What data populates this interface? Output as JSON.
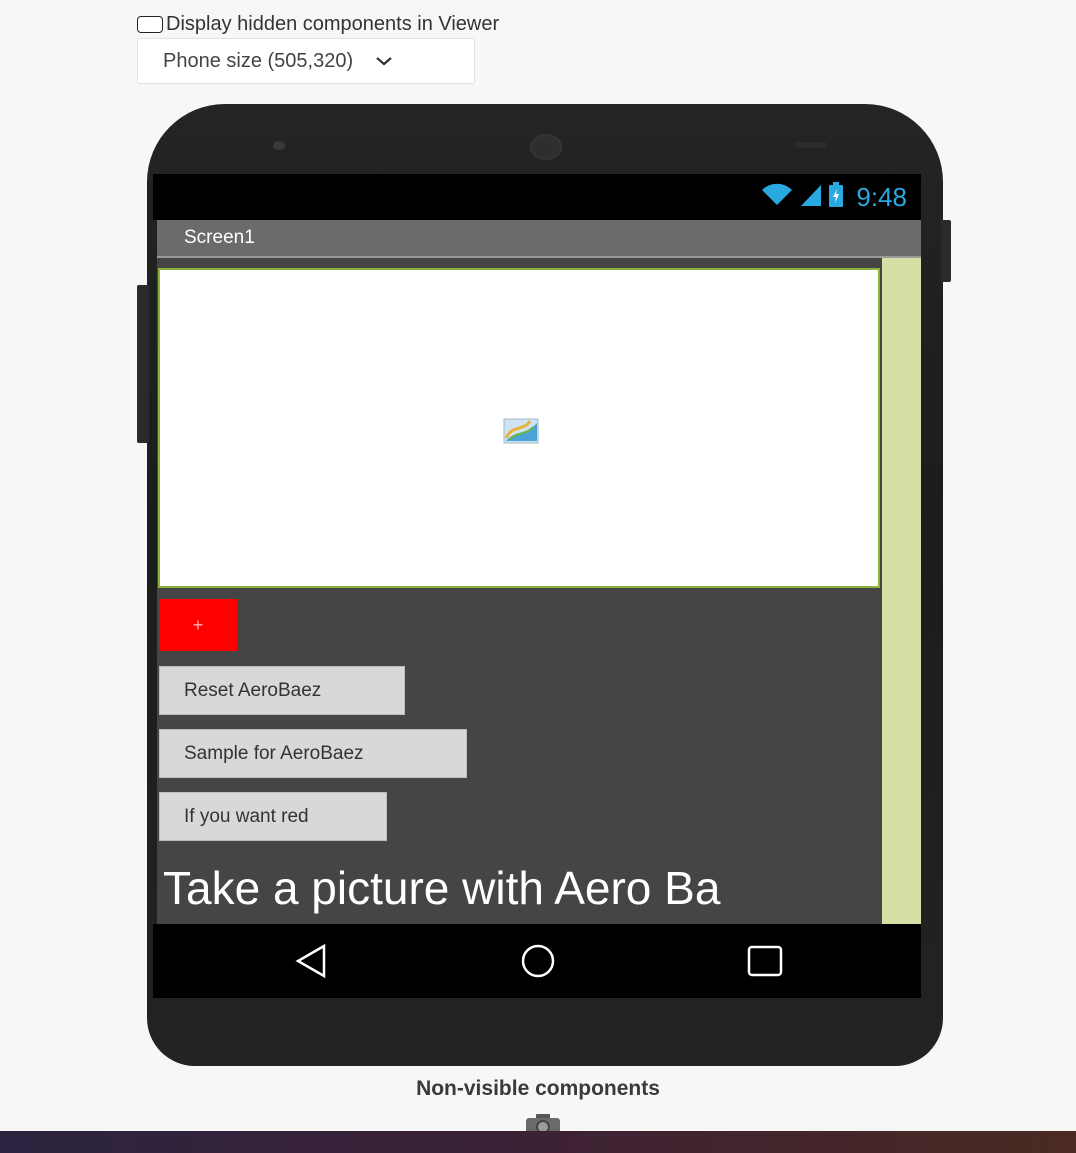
{
  "viewer": {
    "hidden_components_label": "Display hidden components in Viewer",
    "hidden_components_checked": false,
    "size_select_value": "Phone size (505,320)"
  },
  "phone": {
    "status_time": "9:48",
    "screen_title": "Screen1",
    "canvas_image_icon": "image-placeholder-icon",
    "red_button_label": "+",
    "buttons": [
      {
        "label": "Reset AeroBaez"
      },
      {
        "label": "Sample for AeroBaez"
      },
      {
        "label": "If you want red"
      }
    ],
    "big_label": "Take a picture with Aero Ba",
    "nav_icons": [
      "back-icon",
      "home-icon",
      "recents-icon"
    ]
  },
  "non_visible": {
    "heading": "Non-visible components",
    "component_icons": [
      "camera-icon"
    ]
  },
  "colors": {
    "status_clock": "#2aa9e0",
    "canvas_border": "#8db23b",
    "red_button": "#ff0000",
    "screen_background": "#454545",
    "scroll_strip": "#d4e0a6"
  }
}
